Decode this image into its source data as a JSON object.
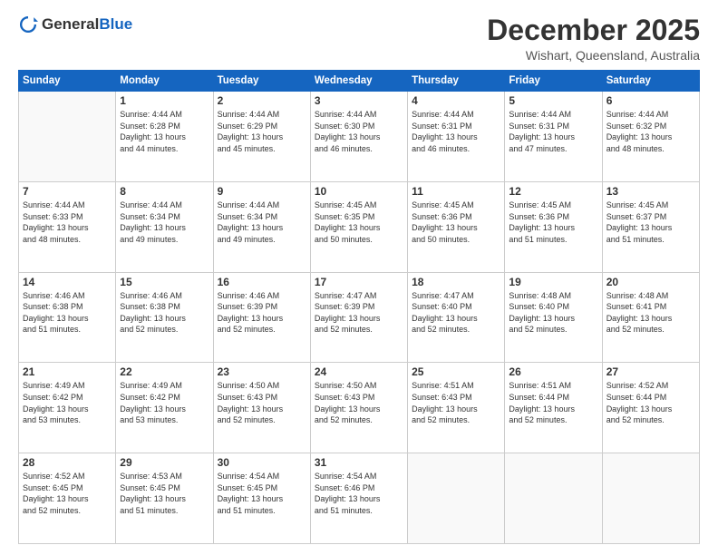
{
  "header": {
    "logo_general": "General",
    "logo_blue": "Blue",
    "month_title": "December 2025",
    "subtitle": "Wishart, Queensland, Australia"
  },
  "days_of_week": [
    "Sunday",
    "Monday",
    "Tuesday",
    "Wednesday",
    "Thursday",
    "Friday",
    "Saturday"
  ],
  "weeks": [
    [
      {
        "day": "",
        "info": ""
      },
      {
        "day": "1",
        "info": "Sunrise: 4:44 AM\nSunset: 6:28 PM\nDaylight: 13 hours\nand 44 minutes."
      },
      {
        "day": "2",
        "info": "Sunrise: 4:44 AM\nSunset: 6:29 PM\nDaylight: 13 hours\nand 45 minutes."
      },
      {
        "day": "3",
        "info": "Sunrise: 4:44 AM\nSunset: 6:30 PM\nDaylight: 13 hours\nand 46 minutes."
      },
      {
        "day": "4",
        "info": "Sunrise: 4:44 AM\nSunset: 6:31 PM\nDaylight: 13 hours\nand 46 minutes."
      },
      {
        "day": "5",
        "info": "Sunrise: 4:44 AM\nSunset: 6:31 PM\nDaylight: 13 hours\nand 47 minutes."
      },
      {
        "day": "6",
        "info": "Sunrise: 4:44 AM\nSunset: 6:32 PM\nDaylight: 13 hours\nand 48 minutes."
      }
    ],
    [
      {
        "day": "7",
        "info": "Sunrise: 4:44 AM\nSunset: 6:33 PM\nDaylight: 13 hours\nand 48 minutes."
      },
      {
        "day": "8",
        "info": "Sunrise: 4:44 AM\nSunset: 6:34 PM\nDaylight: 13 hours\nand 49 minutes."
      },
      {
        "day": "9",
        "info": "Sunrise: 4:44 AM\nSunset: 6:34 PM\nDaylight: 13 hours\nand 49 minutes."
      },
      {
        "day": "10",
        "info": "Sunrise: 4:45 AM\nSunset: 6:35 PM\nDaylight: 13 hours\nand 50 minutes."
      },
      {
        "day": "11",
        "info": "Sunrise: 4:45 AM\nSunset: 6:36 PM\nDaylight: 13 hours\nand 50 minutes."
      },
      {
        "day": "12",
        "info": "Sunrise: 4:45 AM\nSunset: 6:36 PM\nDaylight: 13 hours\nand 51 minutes."
      },
      {
        "day": "13",
        "info": "Sunrise: 4:45 AM\nSunset: 6:37 PM\nDaylight: 13 hours\nand 51 minutes."
      }
    ],
    [
      {
        "day": "14",
        "info": "Sunrise: 4:46 AM\nSunset: 6:38 PM\nDaylight: 13 hours\nand 51 minutes."
      },
      {
        "day": "15",
        "info": "Sunrise: 4:46 AM\nSunset: 6:38 PM\nDaylight: 13 hours\nand 52 minutes."
      },
      {
        "day": "16",
        "info": "Sunrise: 4:46 AM\nSunset: 6:39 PM\nDaylight: 13 hours\nand 52 minutes."
      },
      {
        "day": "17",
        "info": "Sunrise: 4:47 AM\nSunset: 6:39 PM\nDaylight: 13 hours\nand 52 minutes."
      },
      {
        "day": "18",
        "info": "Sunrise: 4:47 AM\nSunset: 6:40 PM\nDaylight: 13 hours\nand 52 minutes."
      },
      {
        "day": "19",
        "info": "Sunrise: 4:48 AM\nSunset: 6:40 PM\nDaylight: 13 hours\nand 52 minutes."
      },
      {
        "day": "20",
        "info": "Sunrise: 4:48 AM\nSunset: 6:41 PM\nDaylight: 13 hours\nand 52 minutes."
      }
    ],
    [
      {
        "day": "21",
        "info": "Sunrise: 4:49 AM\nSunset: 6:42 PM\nDaylight: 13 hours\nand 53 minutes."
      },
      {
        "day": "22",
        "info": "Sunrise: 4:49 AM\nSunset: 6:42 PM\nDaylight: 13 hours\nand 53 minutes."
      },
      {
        "day": "23",
        "info": "Sunrise: 4:50 AM\nSunset: 6:43 PM\nDaylight: 13 hours\nand 52 minutes."
      },
      {
        "day": "24",
        "info": "Sunrise: 4:50 AM\nSunset: 6:43 PM\nDaylight: 13 hours\nand 52 minutes."
      },
      {
        "day": "25",
        "info": "Sunrise: 4:51 AM\nSunset: 6:43 PM\nDaylight: 13 hours\nand 52 minutes."
      },
      {
        "day": "26",
        "info": "Sunrise: 4:51 AM\nSunset: 6:44 PM\nDaylight: 13 hours\nand 52 minutes."
      },
      {
        "day": "27",
        "info": "Sunrise: 4:52 AM\nSunset: 6:44 PM\nDaylight: 13 hours\nand 52 minutes."
      }
    ],
    [
      {
        "day": "28",
        "info": "Sunrise: 4:52 AM\nSunset: 6:45 PM\nDaylight: 13 hours\nand 52 minutes."
      },
      {
        "day": "29",
        "info": "Sunrise: 4:53 AM\nSunset: 6:45 PM\nDaylight: 13 hours\nand 51 minutes."
      },
      {
        "day": "30",
        "info": "Sunrise: 4:54 AM\nSunset: 6:45 PM\nDaylight: 13 hours\nand 51 minutes."
      },
      {
        "day": "31",
        "info": "Sunrise: 4:54 AM\nSunset: 6:46 PM\nDaylight: 13 hours\nand 51 minutes."
      },
      {
        "day": "",
        "info": ""
      },
      {
        "day": "",
        "info": ""
      },
      {
        "day": "",
        "info": ""
      }
    ]
  ]
}
